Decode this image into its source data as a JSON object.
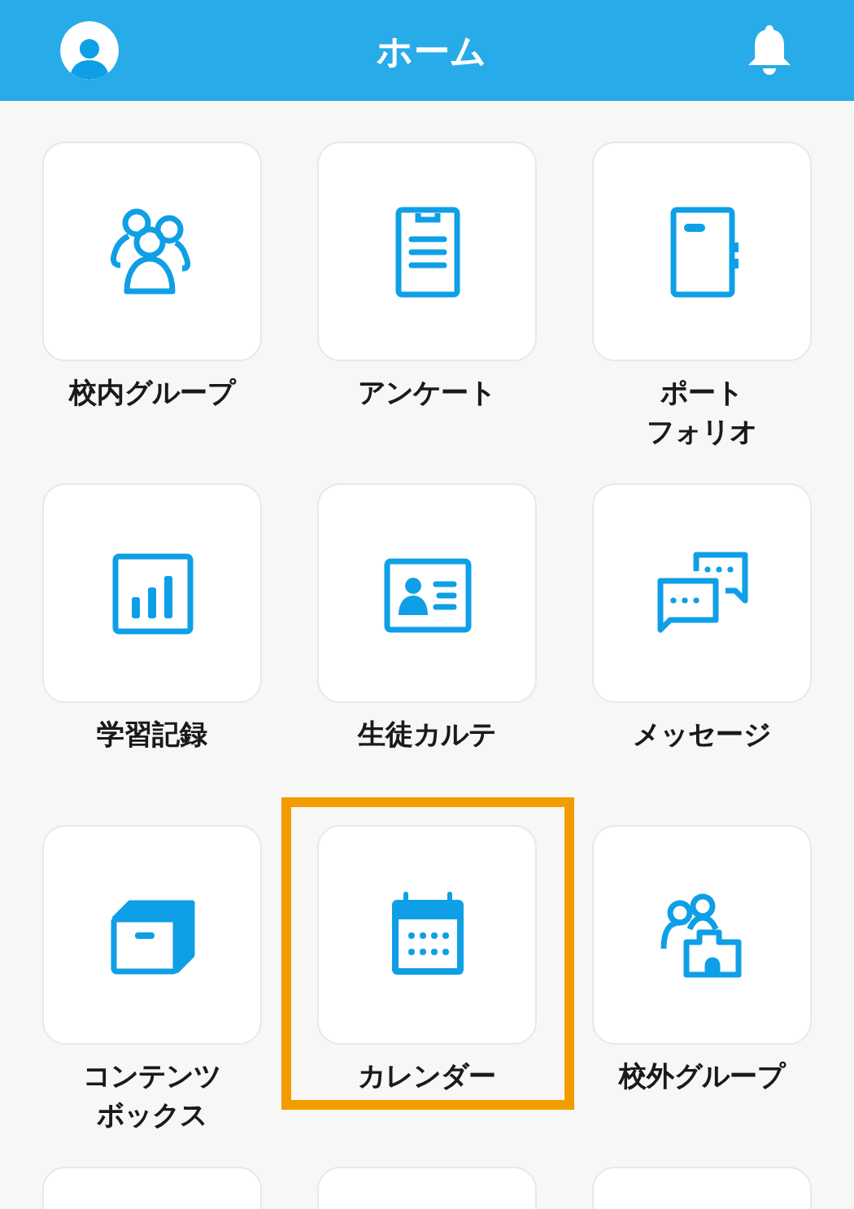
{
  "header": {
    "title": "ホーム"
  },
  "tiles": [
    {
      "kind": "group",
      "label": "校内グループ",
      "selected": false
    },
    {
      "kind": "survey",
      "label": "アンケート",
      "selected": false
    },
    {
      "kind": "notebook",
      "label_lines": [
        "ポート",
        "フォリオ"
      ],
      "selected": false
    },
    {
      "kind": "chart",
      "label": "学習記録",
      "selected": false
    },
    {
      "kind": "card",
      "label": "生徒カルテ",
      "selected": false
    },
    {
      "kind": "chat",
      "label": "メッセージ",
      "selected": false
    },
    {
      "kind": "box",
      "label_lines": [
        "コンテンツ",
        "ボックス"
      ],
      "selected": false
    },
    {
      "kind": "calendar",
      "label": "カレンダー",
      "selected": true
    },
    {
      "kind": "school",
      "label": "校外グループ",
      "selected": false
    },
    {
      "kind": "blank",
      "selected": false
    },
    {
      "kind": "blank",
      "selected": false
    },
    {
      "kind": "blank",
      "selected": false
    }
  ]
}
